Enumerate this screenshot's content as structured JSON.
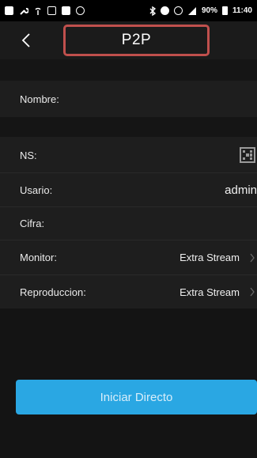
{
  "status_bar": {
    "left_icons": [
      "gallery-icon",
      "wrench-icon",
      "signal-icon",
      "instagram-icon",
      "image-icon",
      "shield-icon"
    ],
    "right_icons": [
      "bluetooth-icon",
      "do-not-disturb-icon",
      "alarm-icon",
      "4g-signal-icon"
    ],
    "battery_text": "90%",
    "time": "11:40"
  },
  "header": {
    "back_icon": "chevron-left-icon",
    "title": "P2P",
    "highlight_color": "#c0504d"
  },
  "form": {
    "name": {
      "label": "Nombre:",
      "value": ""
    },
    "ns": {
      "label": "NS:",
      "icon": "qr-scan-icon"
    },
    "user": {
      "label": "Usario:",
      "value": "admin"
    },
    "password": {
      "label": "Cifra:",
      "value": ""
    },
    "monitor": {
      "label": "Monitor:",
      "value": "Extra Stream"
    },
    "playback": {
      "label": "Reproduccion:",
      "value": "Extra Stream"
    }
  },
  "actions": {
    "start_label": "Iniciar Directo",
    "button_color": "#2aa7e3"
  }
}
